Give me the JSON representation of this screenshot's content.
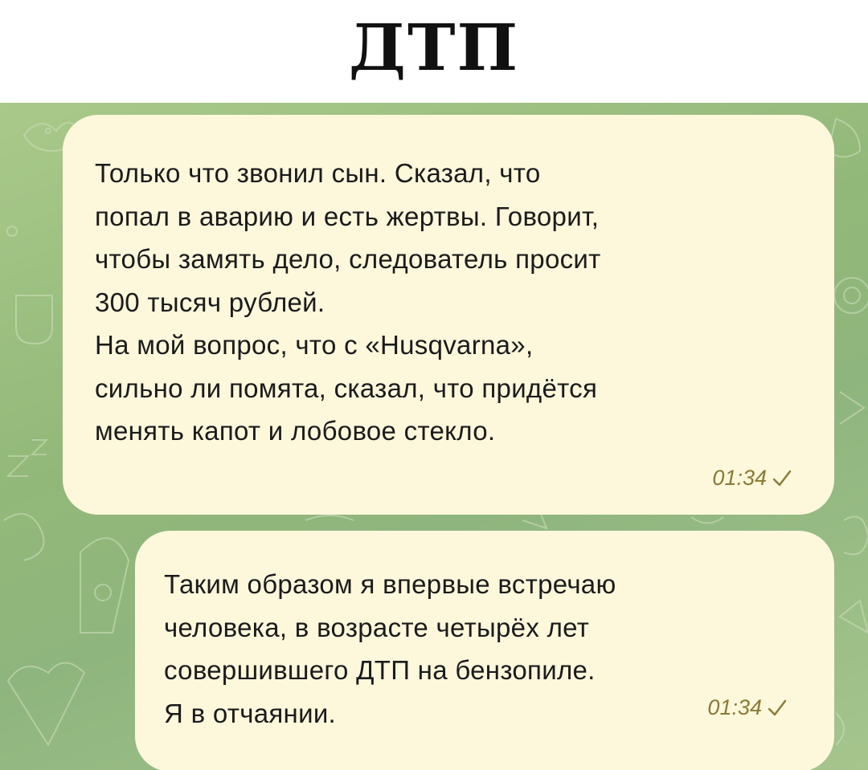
{
  "header": {
    "title": "ДТП"
  },
  "messages": [
    {
      "text": "Только что звонил сын. Сказал, что\nпопал в аварию и есть жертвы. Говорит,\nчтобы замять дело, следователь просит\n300 тысяч рублей.\nНа мой вопрос, что с «Husqvarna»,\nсильно ли помята, сказал, что придётся\nменять капот и лобовое стекло.",
      "time": "01:34",
      "status_icon": "check-icon"
    },
    {
      "text": "Таким образом я впервые встречаю\nчеловека, в возрасте четырёх лет\nсовершившего ДТП на бензопиле.\nЯ в отчаянии.",
      "time": "01:34",
      "status_icon": "check-icon"
    }
  ],
  "colors": {
    "bubble": "#fdf7dc",
    "background": "#9dbf83",
    "timestamp": "#8b7a35"
  }
}
